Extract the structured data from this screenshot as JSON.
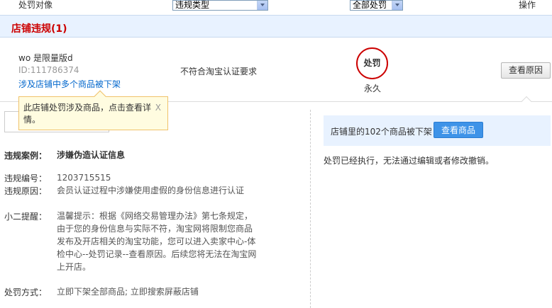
{
  "header": {
    "col_target": "处罚对像",
    "violation_type_select": "违规类型",
    "all_penalties_select": "全部处罚",
    "col_action": "操作"
  },
  "section": {
    "title": "店铺违规(1)"
  },
  "shop": {
    "name": "wo 是限量版d",
    "id": "ID:111786374",
    "link": "涉及店铺中多个商品被下架",
    "reason": "不符合淘宝认证要求",
    "penalty_badge": "处罚",
    "duration": "永久",
    "view_reason_button": "查看原因"
  },
  "tooltip": {
    "text": "此店铺处罚涉及商品，点击查看详情。",
    "close": "X"
  },
  "detail": {
    "case_label": "违规案例：",
    "case_value": "涉嫌伪造认证信息",
    "number_label": "违规编号：",
    "number_value": "1203715515",
    "reason_label": "违规原因：",
    "reason_value": "会员认证过程中涉嫌使用虚假的身份信息进行认证",
    "tip_label": "小二提醒：",
    "tip_line1": "温馨提示：根据《网络交易管理办法》第七条规定，",
    "tip_line2": "由于您的身份信息与实际不符，淘宝网将限制您商品",
    "tip_line3": "发布及开店相关的淘宝功能，您可以进入卖家中心-体",
    "tip_line4": "检中心--处罚记录--查看原因。后续您将无法在淘宝网",
    "tip_line5": "上开店。",
    "method_label": "处罚方式：",
    "method_value": "立即下架全部商品; 立即搜索屏蔽店铺"
  },
  "right": {
    "removed_text": "店铺里的102个商品被下架",
    "view_goods_button": "查看商品",
    "executed_text": "处罚已经执行，无法通过编辑或者修改撤销。"
  }
}
